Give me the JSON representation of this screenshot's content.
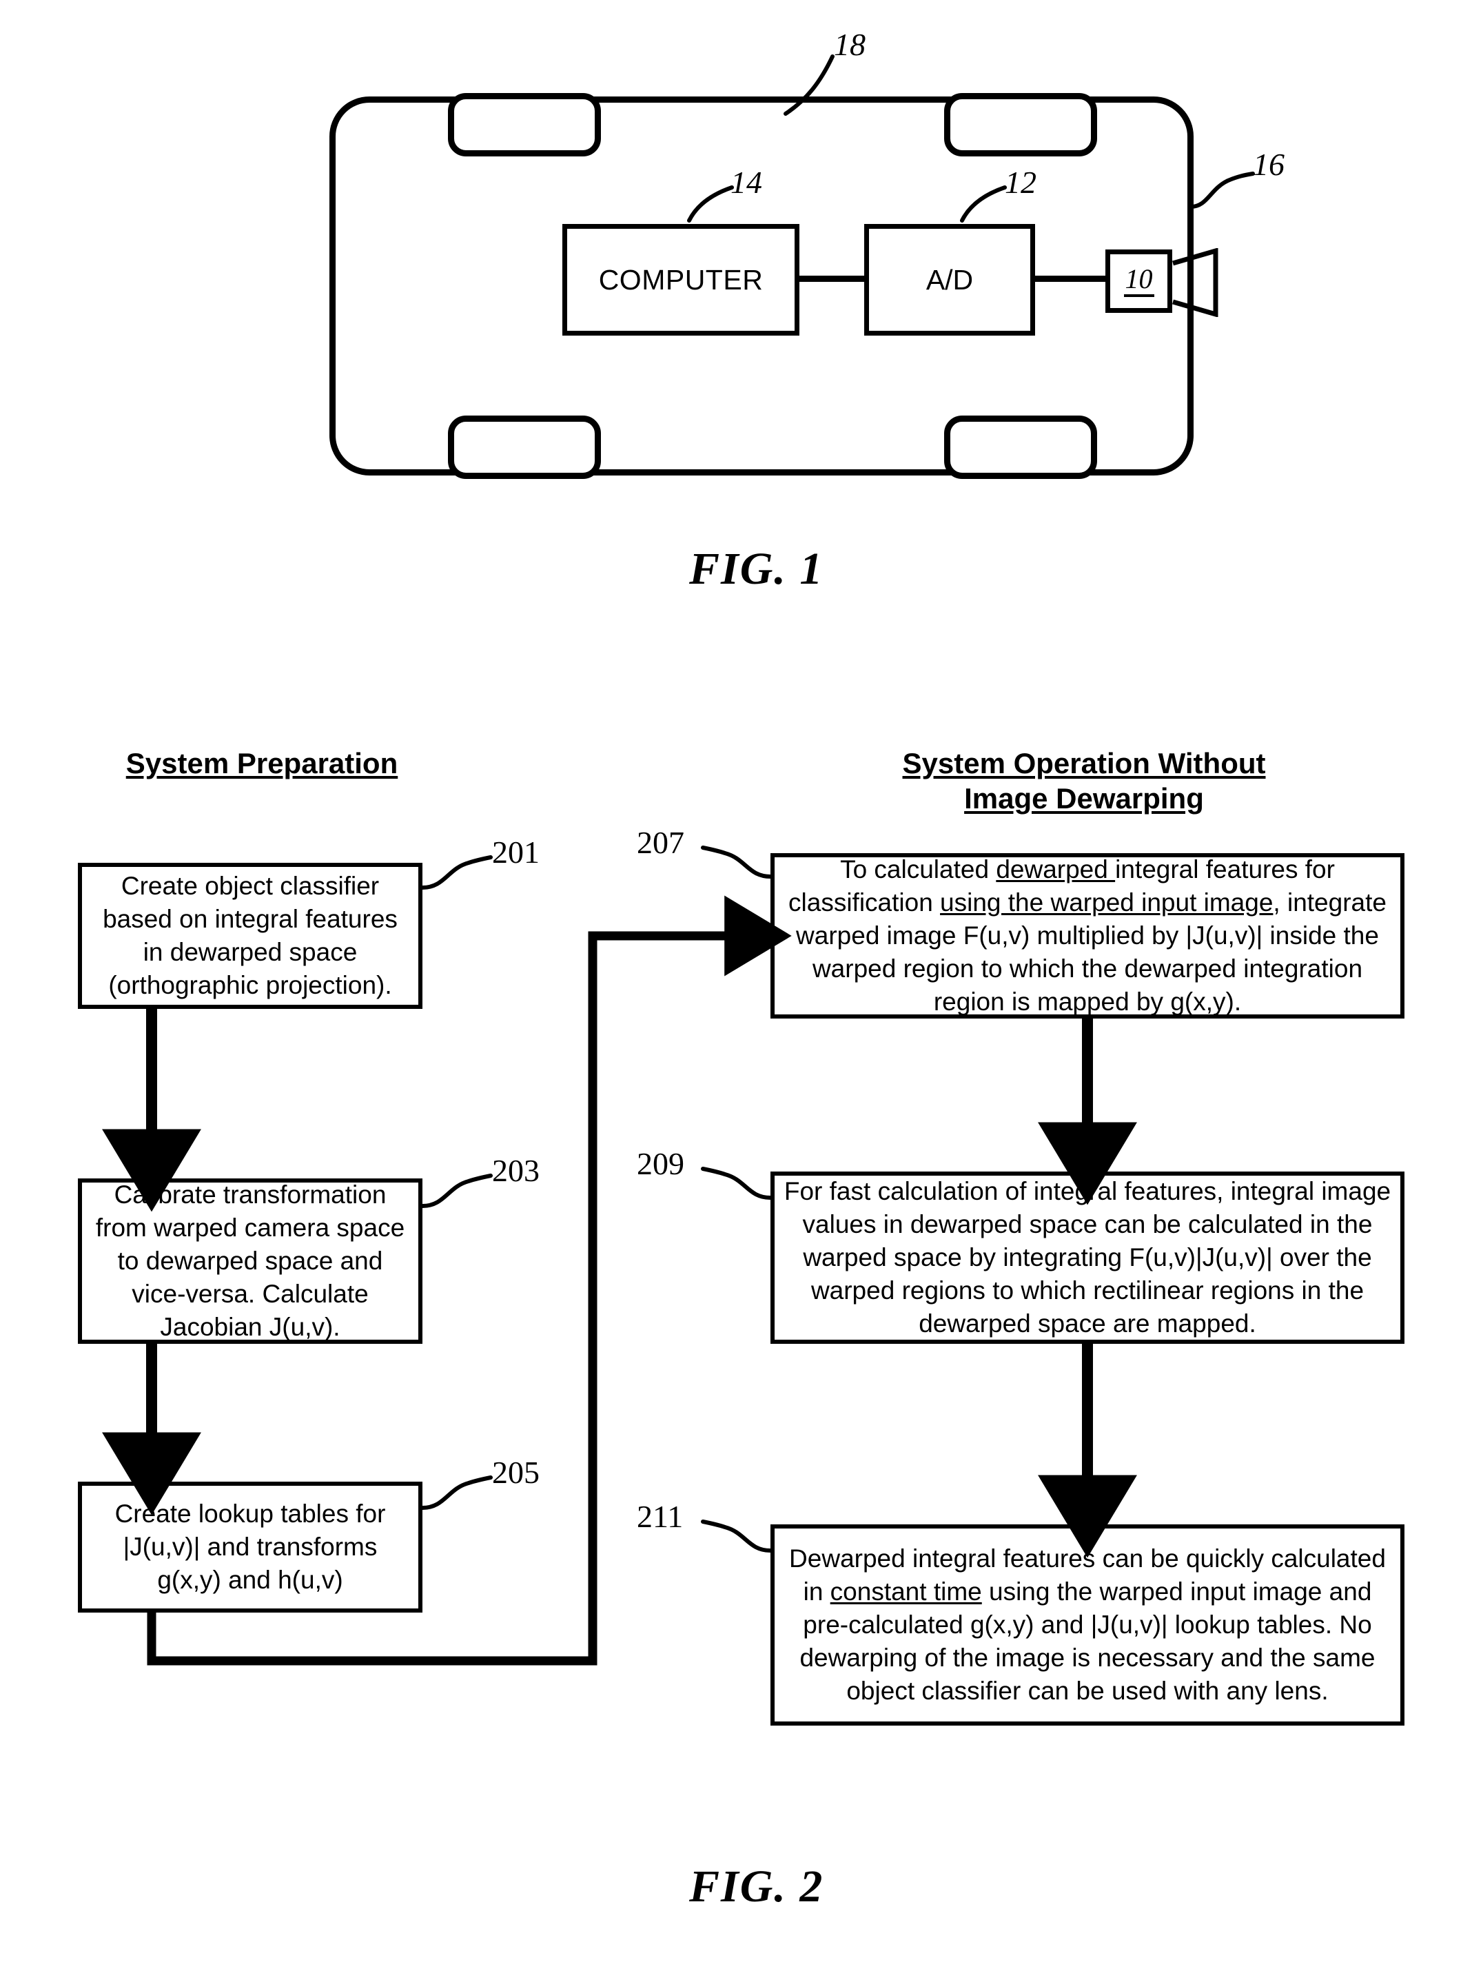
{
  "figure1": {
    "caption": "FIG.  1",
    "boxes": {
      "computer": "COMPUTER",
      "ad": "A/D",
      "camera": "10"
    },
    "callouts": {
      "vehicle": "18",
      "computer": "14",
      "ad": "12",
      "camera_mount": "16"
    }
  },
  "figure2": {
    "caption": "FIG.  2",
    "columns": {
      "left": {
        "header": "System Preparation",
        "steps": [
          {
            "ref": "201",
            "text": "Create object classifier based on integral features in dewarped space (orthographic projection)."
          },
          {
            "ref": "203",
            "text": "Calibrate transformation from warped camera space to dewarped space and vice-versa. Calculate Jacobian J(u,v)."
          },
          {
            "ref": "205",
            "text": "Create lookup tables for |J(u,v)| and transforms g(x,y) and h(u,v)"
          }
        ]
      },
      "right": {
        "header_line1": "System Operation Without",
        "header_line2": "Image Dewarping",
        "steps": [
          {
            "ref": "207",
            "html": "To calculated <u>dewarped </u>integral features for classification <u>using the warped input image</u>, integrate warped image F(u,v) multiplied by |J(u,v)| inside the warped region to which the dewarped integration region is mapped by g(x,y)."
          },
          {
            "ref": "209",
            "html": "For fast calculation of integral features, integral image values in dewarped space can be calculated in the warped space by integrating F(u,v)|J(u,v)| over the warped regions to which rectilinear regions in the dewarped space are mapped."
          },
          {
            "ref": "211",
            "html": "Dewarped integral features can be quickly calculated in <u>constant time</u> using the warped input image and pre-calculated g(x,y) and |J(u,v)| lookup tables. No dewarping of the image is necessary and the same object classifier can be used with any lens."
          }
        ]
      }
    }
  }
}
